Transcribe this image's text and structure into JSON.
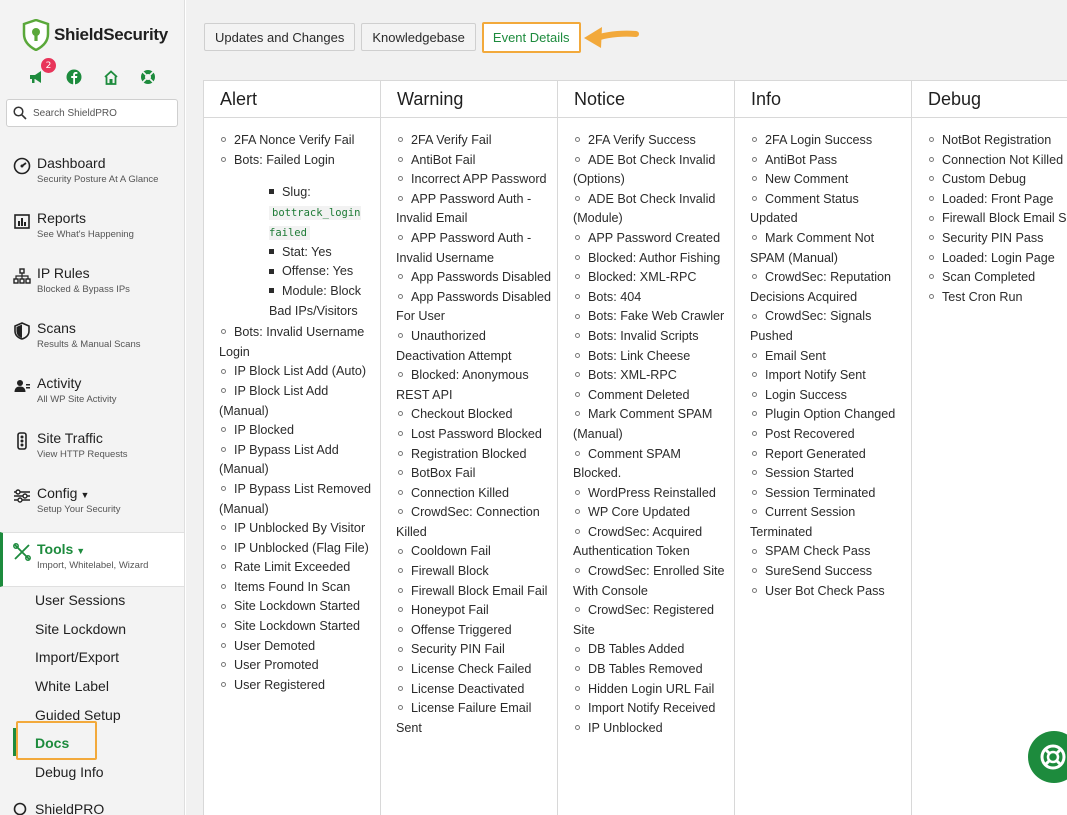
{
  "brand": {
    "name": "ShieldSecurity",
    "accent": "#1d8b3d",
    "highlight": "#f2a93b"
  },
  "header_icons": {
    "notifications_count": "2",
    "icons": [
      "megaphone-icon",
      "facebook-icon",
      "home-icon",
      "lifebuoy-icon"
    ]
  },
  "search": {
    "placeholder": "Search ShieldPRO"
  },
  "nav": [
    {
      "title": "Dashboard",
      "sub": "Security Posture At A Glance",
      "icon": "dashboard-icon"
    },
    {
      "title": "Reports",
      "sub": "See What's Happening",
      "icon": "reports-icon"
    },
    {
      "title": "IP Rules",
      "sub": "Blocked & Bypass IPs",
      "icon": "network-icon"
    },
    {
      "title": "Scans",
      "sub": "Results & Manual Scans",
      "icon": "shield-icon"
    },
    {
      "title": "Activity",
      "sub": "All WP Site Activity",
      "icon": "users-icon"
    },
    {
      "title": "Site Traffic",
      "sub": "View HTTP Requests",
      "icon": "traffic-icon"
    },
    {
      "title": "Config",
      "sub": "Setup Your Security",
      "icon": "sliders-icon"
    },
    {
      "title": "Tools",
      "sub": "Import, Whitelabel, Wizard",
      "icon": "tools-icon"
    }
  ],
  "subnav": [
    "User Sessions",
    "Site Lockdown",
    "Import/Export",
    "White Label",
    "Guided Setup",
    "Docs",
    "Debug Info"
  ],
  "shieldpro_label": "ShieldPRO",
  "tabs": [
    "Updates and Changes",
    "Knowledgebase",
    "Event Details"
  ],
  "columns": {
    "alert": {
      "title": "Alert",
      "items_before": [
        "2FA Nonce Verify Fail",
        "Bots: Failed Login"
      ],
      "nested": {
        "slug_label": "Slug:",
        "slug_code": "bottrack_login failed",
        "stat": "Stat: Yes",
        "offense": "Offense: Yes",
        "module": "Module: Block Bad IPs/Visitors"
      },
      "items_after": [
        "Bots: Invalid Username Login",
        "IP Block List Add (Auto)",
        "IP Block List Add (Manual)",
        "IP Blocked",
        "IP Bypass List Add (Manual)",
        "IP Bypass List Removed (Manual)",
        "IP Unblocked By Visitor",
        "IP Unblocked (Flag File)",
        "Rate Limit Exceeded",
        "Items Found In Scan",
        "Site Lockdown Started",
        "Site Lockdown Started",
        "User Demoted",
        "User Promoted",
        "User Registered"
      ]
    },
    "warning": {
      "title": "Warning",
      "items": [
        "2FA Verify Fail",
        "AntiBot Fail",
        "Incorrect APP Password",
        "APP Password Auth - Invalid Email",
        "APP Password Auth - Invalid Username",
        "App Passwords Disabled",
        "App Passwords Disabled For User",
        "Unauthorized Deactivation Attempt",
        "Blocked: Anonymous REST API",
        "Checkout Blocked",
        "Lost Password Blocked",
        "Registration Blocked",
        "BotBox Fail",
        "Connection Killed",
        "CrowdSec: Connection Killed",
        "Cooldown Fail",
        "Firewall Block",
        "Firewall Block Email Fail",
        "Honeypot Fail",
        "Offense Triggered",
        "Security PIN Fail",
        "License Check Failed",
        "License Deactivated",
        "License Failure Email Sent"
      ]
    },
    "notice": {
      "title": "Notice",
      "items": [
        "2FA Verify Success",
        "ADE Bot Check Invalid (Options)",
        "ADE Bot Check Invalid (Module)",
        "APP Password Created",
        "Blocked: Author Fishing",
        "Blocked: XML-RPC",
        "Bots: 404",
        "Bots: Fake Web Crawler",
        "Bots: Invalid Scripts",
        "Bots: Link Cheese",
        "Bots: XML-RPC",
        "Comment Deleted",
        "Mark Comment SPAM (Manual)",
        "Comment SPAM Blocked.",
        "WordPress Reinstalled",
        "WP Core Updated",
        "CrowdSec: Acquired Authentication Token",
        "CrowdSec: Enrolled Site With Console",
        "CrowdSec: Registered Site",
        "DB Tables Added",
        "DB Tables Removed",
        "Hidden Login URL Fail",
        "Import Notify Received",
        "IP Unblocked"
      ]
    },
    "info": {
      "title": "Info",
      "items": [
        "2FA Login Success",
        "AntiBot Pass",
        "New Comment",
        "Comment Status Updated",
        "Mark Comment Not SPAM (Manual)",
        "CrowdSec: Reputation Decisions Acquired",
        "CrowdSec: Signals Pushed",
        "Email Sent",
        "Import Notify Sent",
        "Login Success",
        "Plugin Option Changed",
        "Post Recovered",
        "Report Generated",
        "Session Started",
        "Session Terminated",
        "Current Session Terminated",
        "SPAM Check Pass",
        "SureSend Success",
        "User Bot Check Pass"
      ]
    },
    "debug": {
      "title": "Debug",
      "items": [
        "NotBot Registration",
        "Connection Not Killed",
        "Custom Debug",
        "Loaded: Front Page",
        "Firewall Block Email Success",
        "Security PIN Pass",
        "Loaded: Login Page",
        "Scan Completed",
        "Test Cron Run"
      ]
    }
  }
}
